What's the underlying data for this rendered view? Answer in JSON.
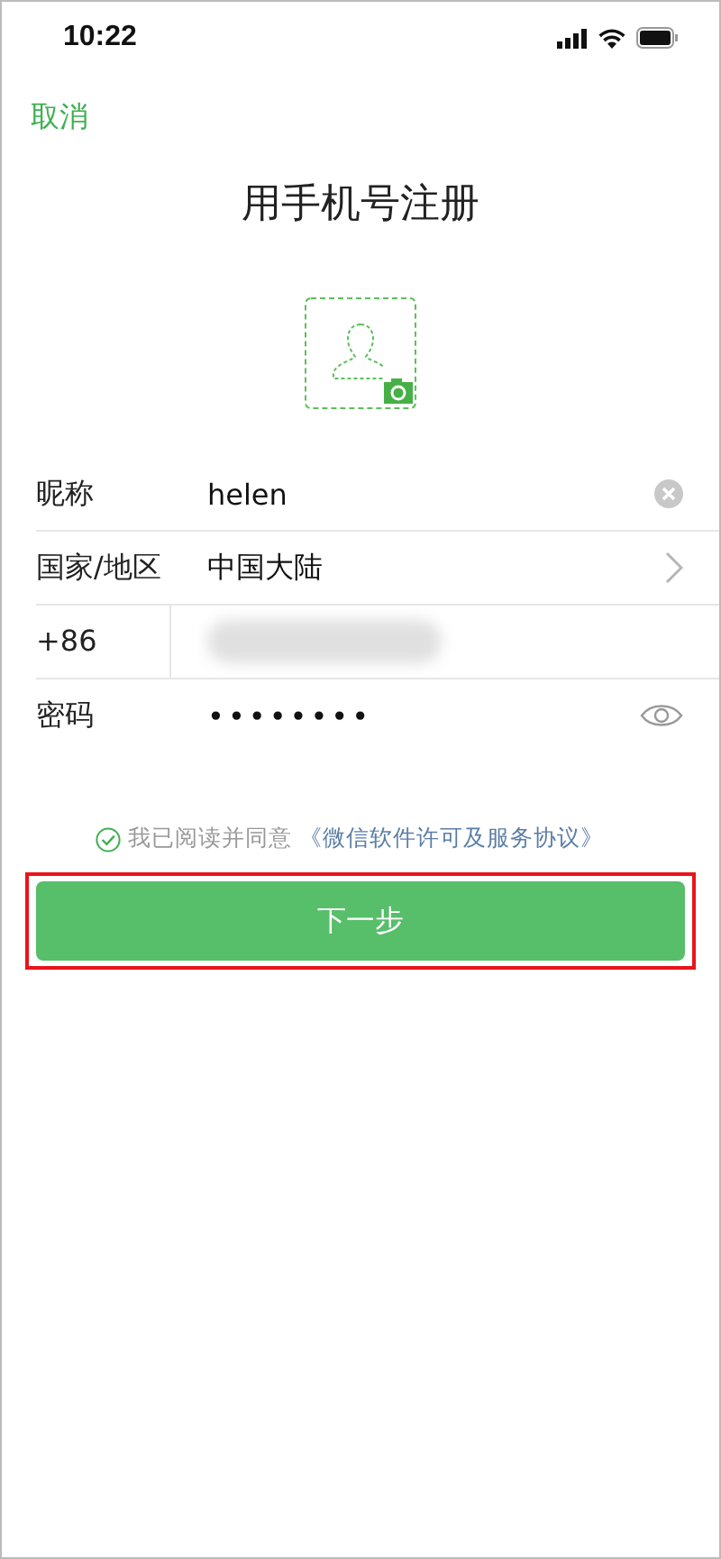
{
  "status_bar": {
    "time": "10:22"
  },
  "nav": {
    "cancel": "取消"
  },
  "title": "用手机号注册",
  "fields": [
    {
      "kind": "text",
      "label": "昵称",
      "value": "helen",
      "clearable": true
    },
    {
      "kind": "select",
      "label": "国家/地区",
      "value": "中国大陆"
    },
    {
      "kind": "phone",
      "label": "+86",
      "blurred": true
    },
    {
      "kind": "password",
      "label": "密码",
      "value": "••••••••"
    }
  ],
  "agreement": {
    "checked": true,
    "text": "我已阅读并同意",
    "link": "《微信软件许可及服务协议》"
  },
  "next_button": {
    "label": "下一步",
    "highlighted": true
  }
}
